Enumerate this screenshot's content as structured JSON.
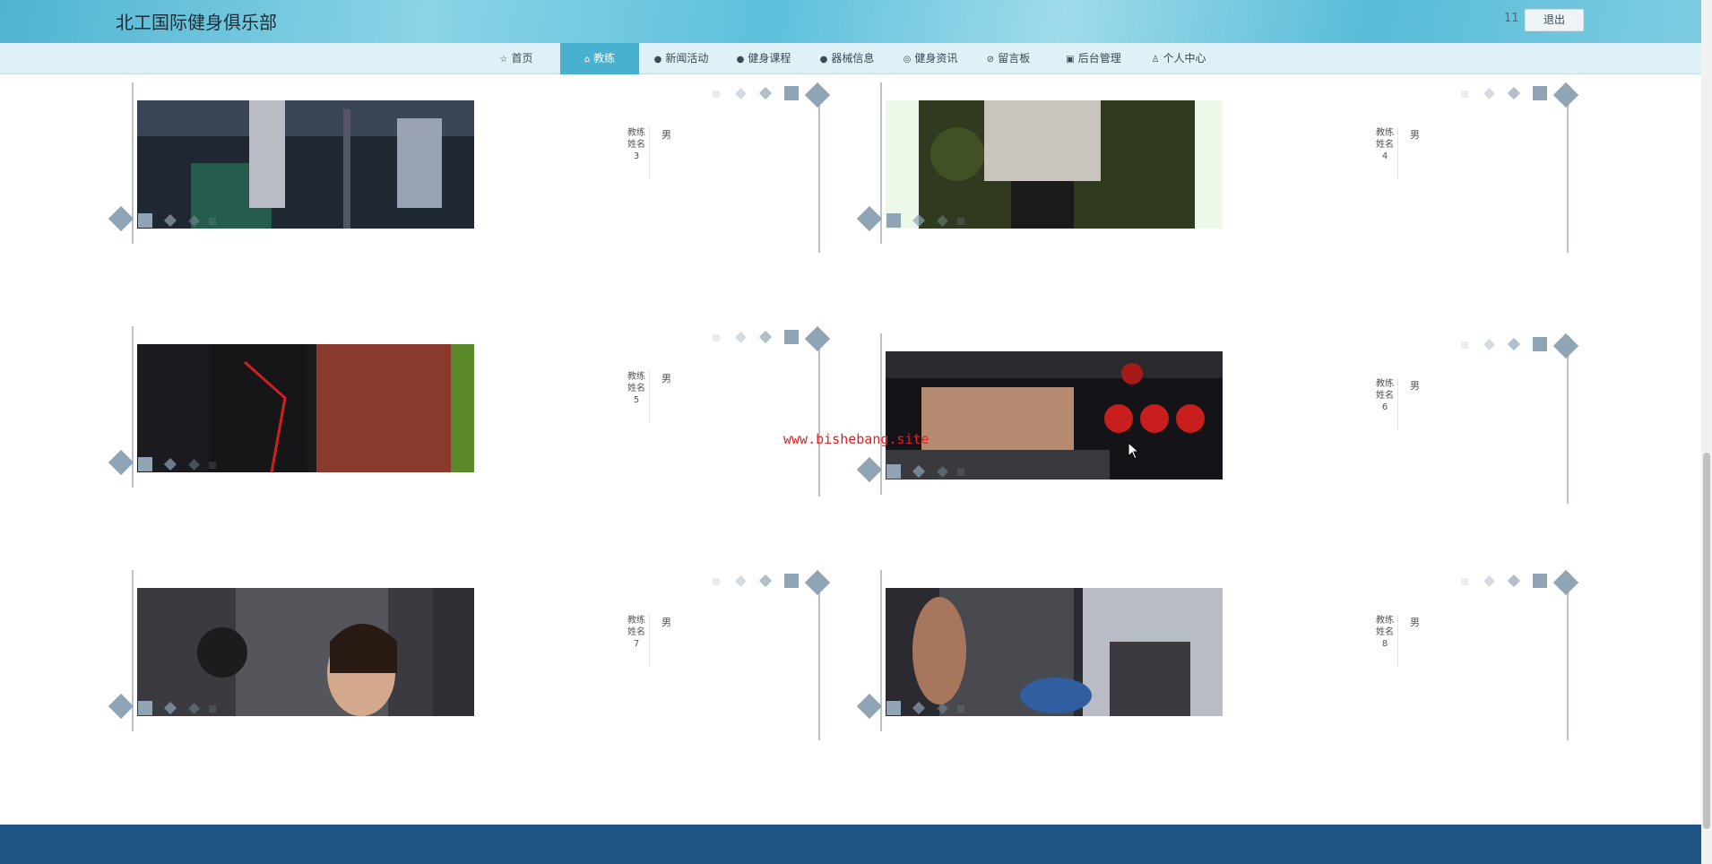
{
  "header": {
    "brand": "北工国际健身俱乐部",
    "user_name": "11",
    "logout_label": "退出"
  },
  "nav": {
    "items": [
      {
        "label": "首页",
        "icon": "star-icon",
        "glyph": "☆"
      },
      {
        "label": "教练",
        "icon": "home-icon",
        "glyph": "⌂",
        "active": true
      },
      {
        "label": "新闻活动",
        "icon": "info-icon",
        "glyph": "●"
      },
      {
        "label": "健身课程",
        "icon": "question-icon",
        "glyph": "●"
      },
      {
        "label": "器械信息",
        "icon": "info-circle-icon",
        "glyph": "●"
      },
      {
        "label": "健身资讯",
        "icon": "globe-icon",
        "glyph": "◎"
      },
      {
        "label": "留言板",
        "icon": "check-circle-icon",
        "glyph": "⊘"
      },
      {
        "label": "后台管理",
        "icon": "clipboard-icon",
        "glyph": "▣"
      },
      {
        "label": "个人中心",
        "icon": "user-icon",
        "glyph": "♙"
      }
    ]
  },
  "coaches": [
    {
      "name": "教练姓名3",
      "gender": "男"
    },
    {
      "name": "教练姓名4",
      "gender": "男"
    },
    {
      "name": "教练姓名5",
      "gender": "男"
    },
    {
      "name": "教练姓名6",
      "gender": "男"
    },
    {
      "name": "教练姓名7",
      "gender": "男"
    },
    {
      "name": "教练姓名8",
      "gender": "男"
    }
  ],
  "watermark": "www.bishebang.site",
  "colors": {
    "accent": "#4ab0d0",
    "footer": "#1f5586",
    "decor": "#8fa4b4"
  }
}
